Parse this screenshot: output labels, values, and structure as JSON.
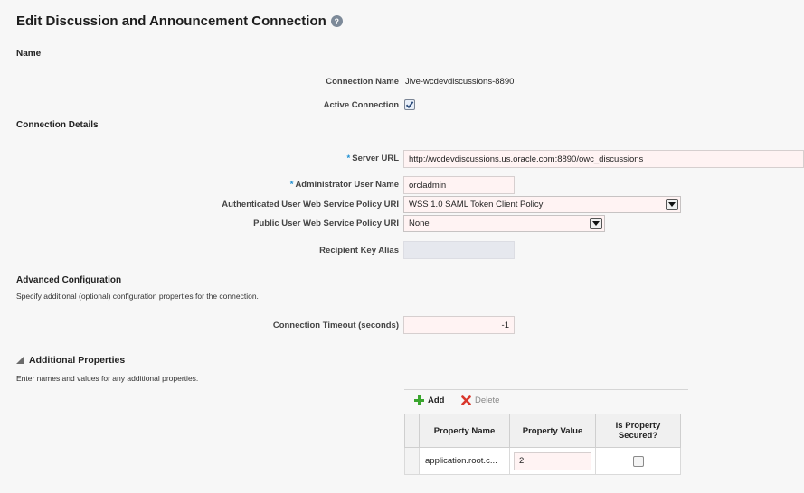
{
  "page": {
    "title": "Edit Discussion and Announcement Connection",
    "help_icon": "help-icon"
  },
  "name_section": {
    "heading": "Name",
    "connection_name_label": "Connection Name",
    "connection_name_value": "Jive-wcdevdiscussions-8890",
    "active_connection_label": "Active Connection",
    "active_connection_checked": true
  },
  "connection_details": {
    "heading": "Connection Details",
    "server_url_label": "Server URL",
    "server_url_value": "http://wcdevdiscussions.us.oracle.com:8890/owc_discussions",
    "admin_user_label": "Administrator User Name",
    "admin_user_value": "orcladmin",
    "auth_policy_label": "Authenticated User Web Service Policy URI",
    "auth_policy_value": "WSS 1.0 SAML Token Client Policy",
    "public_policy_label": "Public User Web Service Policy URI",
    "public_policy_value": "None",
    "recipient_key_label": "Recipient Key Alias",
    "recipient_key_value": ""
  },
  "advanced": {
    "heading": "Advanced Configuration",
    "description": "Specify additional (optional) configuration properties for the connection.",
    "timeout_label": "Connection Timeout (seconds)",
    "timeout_value": "-1"
  },
  "additional": {
    "heading": "Additional Properties",
    "description": "Enter names and values for any additional properties.",
    "add_label": "Add",
    "delete_label": "Delete",
    "columns": [
      "Property Name",
      "Property Value",
      "Is Property Secured?"
    ],
    "rows": [
      {
        "name": "application.root.c...",
        "value": "2",
        "secured": false
      }
    ]
  },
  "colors": {
    "required_marker": "#1c8fd2",
    "add_icon": "#3aa52e",
    "delete_icon": "#d9362b"
  }
}
